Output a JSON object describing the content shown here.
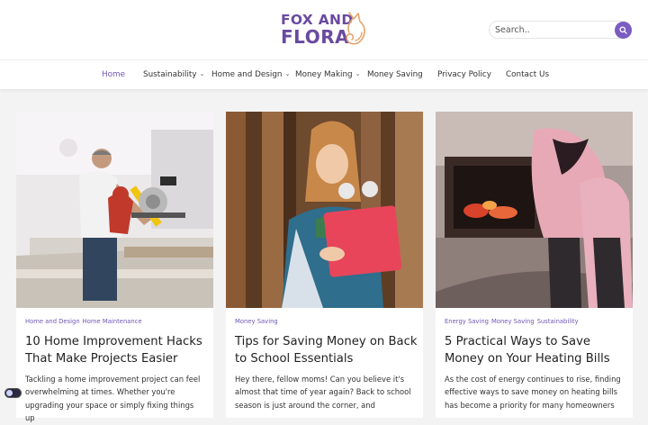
{
  "brand": {
    "line1": "FOX AND",
    "line2": "FLORA",
    "logo_icon": "fox-icon",
    "color": "#6a4aa0"
  },
  "search": {
    "placeholder": "Search..",
    "icon": "search-icon"
  },
  "nav": {
    "items": [
      {
        "label": "Home",
        "active": true,
        "dropdown": false
      },
      {
        "label": "Sustainability",
        "dropdown": true
      },
      {
        "label": "Home and Design",
        "dropdown": true
      },
      {
        "label": "Money Making",
        "dropdown": true
      },
      {
        "label": "Money Saving",
        "dropdown": false
      },
      {
        "label": "Privacy Policy",
        "dropdown": false
      },
      {
        "label": "Contact Us",
        "dropdown": false
      }
    ]
  },
  "posts": [
    {
      "categories": [
        "Home and Design",
        "Home Maintenance"
      ],
      "title": "10 Home Improvement Hacks That Make Projects Easier",
      "excerpt": "Tackling a home improvement project can feel overwhelming at times. Whether you're upgrading your space or simply fixing things up"
    },
    {
      "categories": [
        "Money Saving"
      ],
      "title": "Tips for Saving Money on Back to School Essentials",
      "excerpt": "Hey there, fellow moms! Can you believe it's almost that time of year again? Back to school season is just around the corner, and"
    },
    {
      "categories": [
        "Energy Saving",
        "Money Saving",
        "Sustainability"
      ],
      "title": "5 Practical Ways to Save Money on Your Heating Bills",
      "excerpt": "As the cost of energy continues to rise, finding effective ways to save money on heating bills has become a priority for many homeowners"
    }
  ],
  "colors": {
    "accent": "#6f57b5",
    "search_button": "#7b5cc2"
  }
}
